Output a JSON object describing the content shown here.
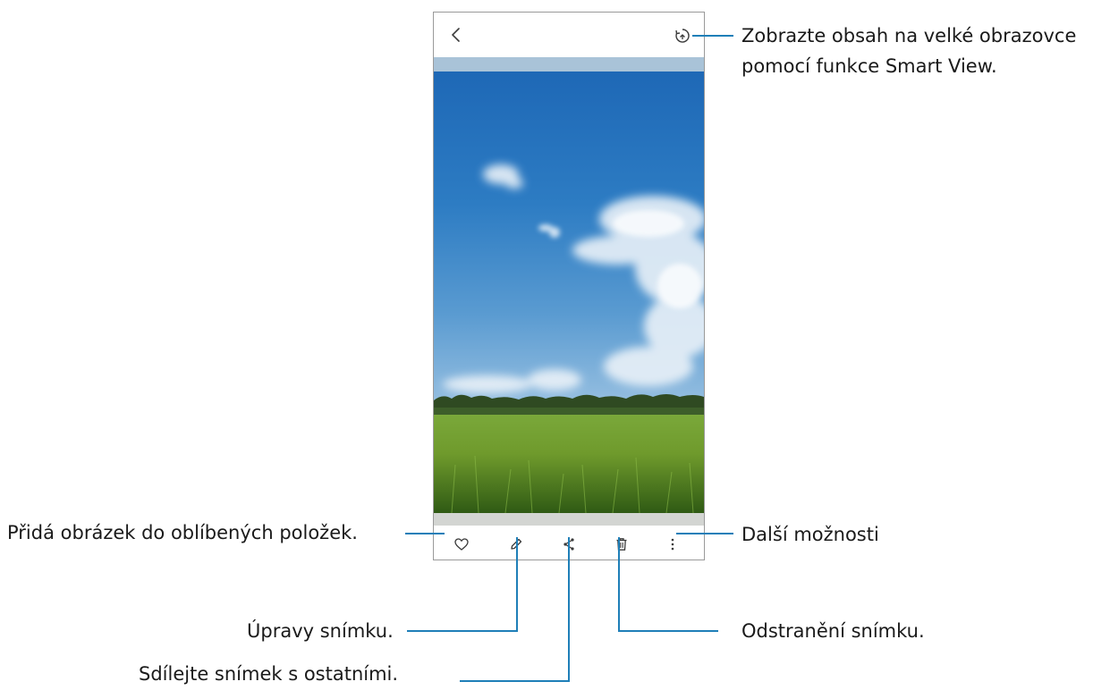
{
  "icons": {
    "back": "chevron-left-icon",
    "smart_view": "smart-view-icon",
    "favorite": "heart-icon",
    "edit": "pencil-icon",
    "share": "share-icon",
    "delete": "trash-icon",
    "more": "more-vertical-icon"
  },
  "callouts": {
    "smart_view_line1": "Zobrazte obsah na velké obrazovce",
    "smart_view_line2": "pomocí funkce Smart View.",
    "favorite": "Přidá obrázek do oblíbených položek.",
    "more": "Další možnosti",
    "edit": "Úpravy snímku.",
    "delete": "Odstranění snímku.",
    "share": "Sdílejte snímek s ostatními."
  },
  "colors": {
    "callout_line": "#1f7fb8",
    "sky_top": "#1e68b6",
    "grass": "#6f9a2c"
  }
}
